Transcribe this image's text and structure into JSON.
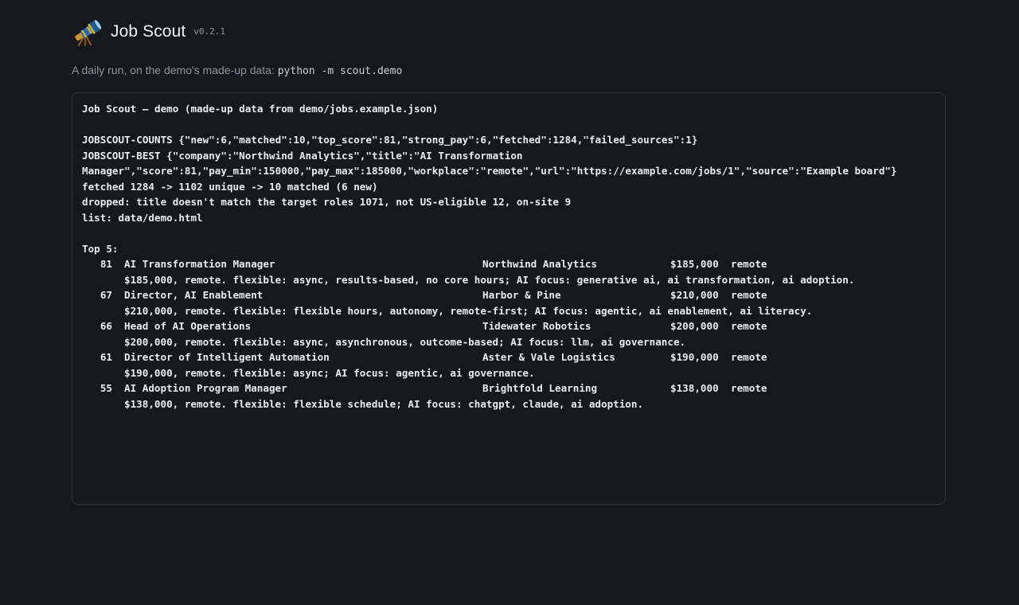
{
  "header": {
    "logo_icon": "telescope-icon",
    "title": "Job Scout",
    "version": "v0.2.1"
  },
  "subtitle": {
    "text": "A daily run, on the demo's made-up data: ",
    "command": "python -m scout.demo"
  },
  "terminal": {
    "intro": "Job Scout — demo (made-up data from demo/jobs.example.json)",
    "counts": "JOBSCOUT-COUNTS {\"new\":6,\"matched\":10,\"top_score\":81,\"strong_pay\":6,\"fetched\":1284,\"failed_sources\":1}",
    "best_line1": "JOBSCOUT-BEST {\"company\":\"Northwind Analytics\",\"title\":\"AI Transformation",
    "best_line2": "Manager\",\"score\":81,\"pay_min\":150000,\"pay_max\":185000,\"workplace\":\"remote\",\"url\":\"https://example.com/jobs/1\",\"source\":\"Example board\"}",
    "fetched": "fetched 1284 -> 1102 unique -> 10 matched (6 new)",
    "dropped": "dropped: title doesn't match the target roles 1071, not US-eligible 12, on-site 9",
    "list": "list: data/demo.html",
    "top_heading": "Top 5:",
    "jobs": [
      {
        "score": "81",
        "title": "AI Transformation Manager",
        "company": "Northwind Analytics",
        "pay": "$185,000",
        "workplace": "remote",
        "detail": "$185,000, remote. flexible: async, results-based, no core hours; AI focus: generative ai, ai transformation, ai adoption."
      },
      {
        "score": "67",
        "title": "Director, AI Enablement",
        "company": "Harbor & Pine",
        "pay": "$210,000",
        "workplace": "remote",
        "detail": "$210,000, remote. flexible: flexible hours, autonomy, remote-first; AI focus: agentic, ai enablement, ai literacy."
      },
      {
        "score": "66",
        "title": "Head of AI Operations",
        "company": "Tidewater Robotics",
        "pay": "$200,000",
        "workplace": "remote",
        "detail": "$200,000, remote. flexible: async, asynchronous, outcome-based; AI focus: llm, ai governance."
      },
      {
        "score": "61",
        "title": "Director of Intelligent Automation",
        "company": "Aster & Vale Logistics",
        "pay": "$190,000",
        "workplace": "remote",
        "detail": "$190,000, remote. flexible: async; AI focus: agentic, ai governance."
      },
      {
        "score": "55",
        "title": "AI Adoption Program Manager",
        "company": "Brightfold Learning",
        "pay": "$138,000",
        "workplace": "remote",
        "detail": "$138,000, remote. flexible: flexible schedule; AI focus: chatgpt, claude, ai adoption."
      }
    ]
  },
  "colors": {
    "background": "#16181d",
    "border": "#30363d",
    "text": "#e6edf3",
    "muted": "#8b949e"
  }
}
